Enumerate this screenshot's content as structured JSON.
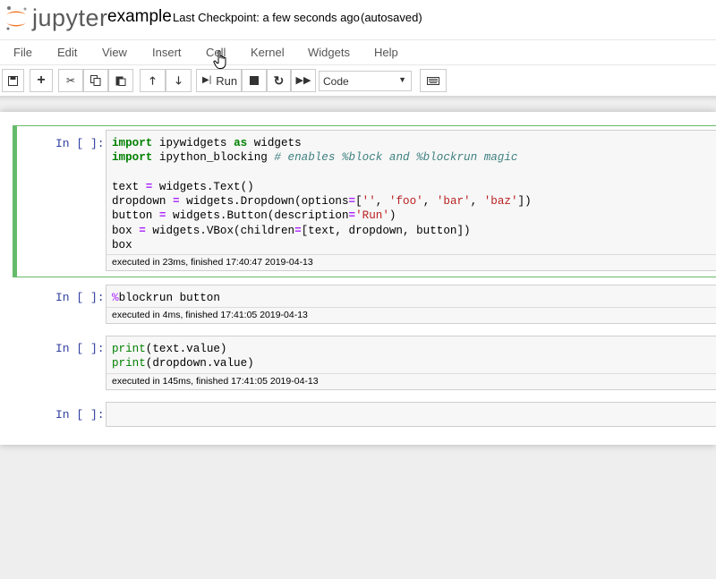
{
  "header": {
    "logo_text": "jupyter",
    "notebook_name": "example",
    "checkpoint": "Last Checkpoint: a few seconds ago",
    "autosave_status": "(autosaved)"
  },
  "menu": {
    "items": [
      "File",
      "Edit",
      "View",
      "Insert",
      "Cell",
      "Kernel",
      "Widgets",
      "Help"
    ]
  },
  "toolbar": {
    "run_label": "Run",
    "cell_type": "Code",
    "icons": [
      "save-icon",
      "plus-icon",
      "cut-icon",
      "copy-icon",
      "paste-icon",
      "arrow-up-icon",
      "arrow-down-icon",
      "step-forward-icon",
      "stop-icon",
      "redo-icon",
      "fast-forward-icon",
      "keyboard-icon"
    ]
  },
  "cells": [
    {
      "prompt": "In [ ]:",
      "lines": [
        "import ipywidgets as widgets",
        "import ipython_blocking # enables %block and %blockrun magic",
        "",
        "text = widgets.Text()",
        "dropdown = widgets.Dropdown(options=['', 'foo', 'bar', 'baz'])",
        "button = widgets.Button(description='Run')",
        "box = widgets.VBox(children=[text, dropdown, button])",
        "box"
      ],
      "exec_info": "executed in 23ms, finished 17:40:47 2019-04-13"
    },
    {
      "prompt": "In [ ]:",
      "lines": [
        "%blockrun button"
      ],
      "exec_info": "executed in 4ms, finished 17:41:05 2019-04-13"
    },
    {
      "prompt": "In [ ]:",
      "lines": [
        "print(text.value)",
        "print(dropdown.value)"
      ],
      "exec_info": "executed in 145ms, finished 17:41:05 2019-04-13"
    },
    {
      "prompt": "In [ ]:",
      "lines": [
        ""
      ],
      "exec_info": ""
    }
  ],
  "colors": {
    "selected_cell_border": "#66bb6a",
    "prompt": "#303f9f",
    "keyword": "#008000",
    "string": "#ba2121",
    "comment": "#408080",
    "magic": "#aa22ff"
  }
}
